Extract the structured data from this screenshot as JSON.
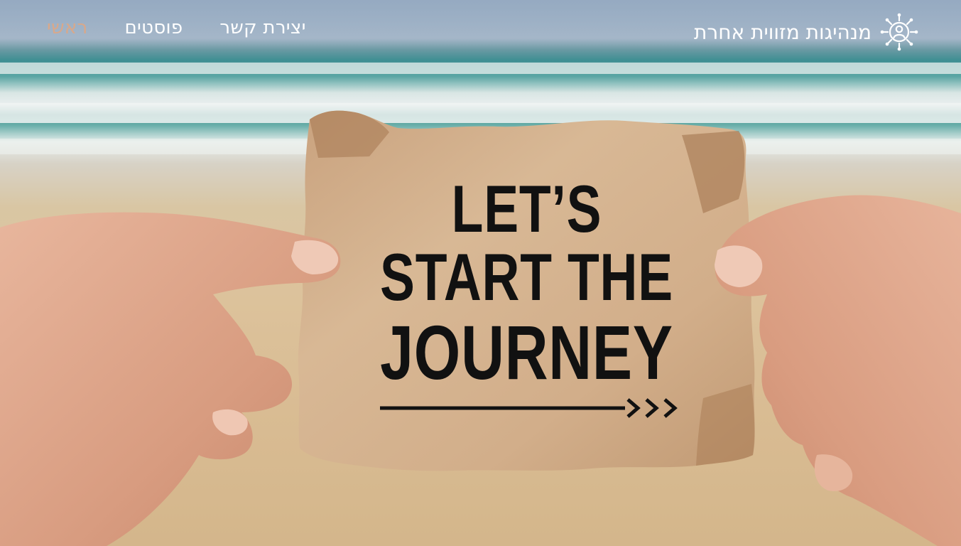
{
  "nav": {
    "brand_title": "מנהיגות מזווית אחרת",
    "links": [
      {
        "label": "ראשי",
        "active": true
      },
      {
        "label": "פוסטים",
        "active": false
      },
      {
        "label": "יצירת קשר",
        "active": false
      }
    ]
  },
  "hero": {
    "note_line1": "LET’S",
    "note_line2": "START THE",
    "note_line3": "JOURNEY"
  },
  "colors": {
    "nav_text": "#ffffff",
    "nav_active": "#d9a88a",
    "note_text": "#111111"
  },
  "icons": {
    "brand": "leader-network-icon",
    "arrow": "journey-arrow-icon"
  }
}
